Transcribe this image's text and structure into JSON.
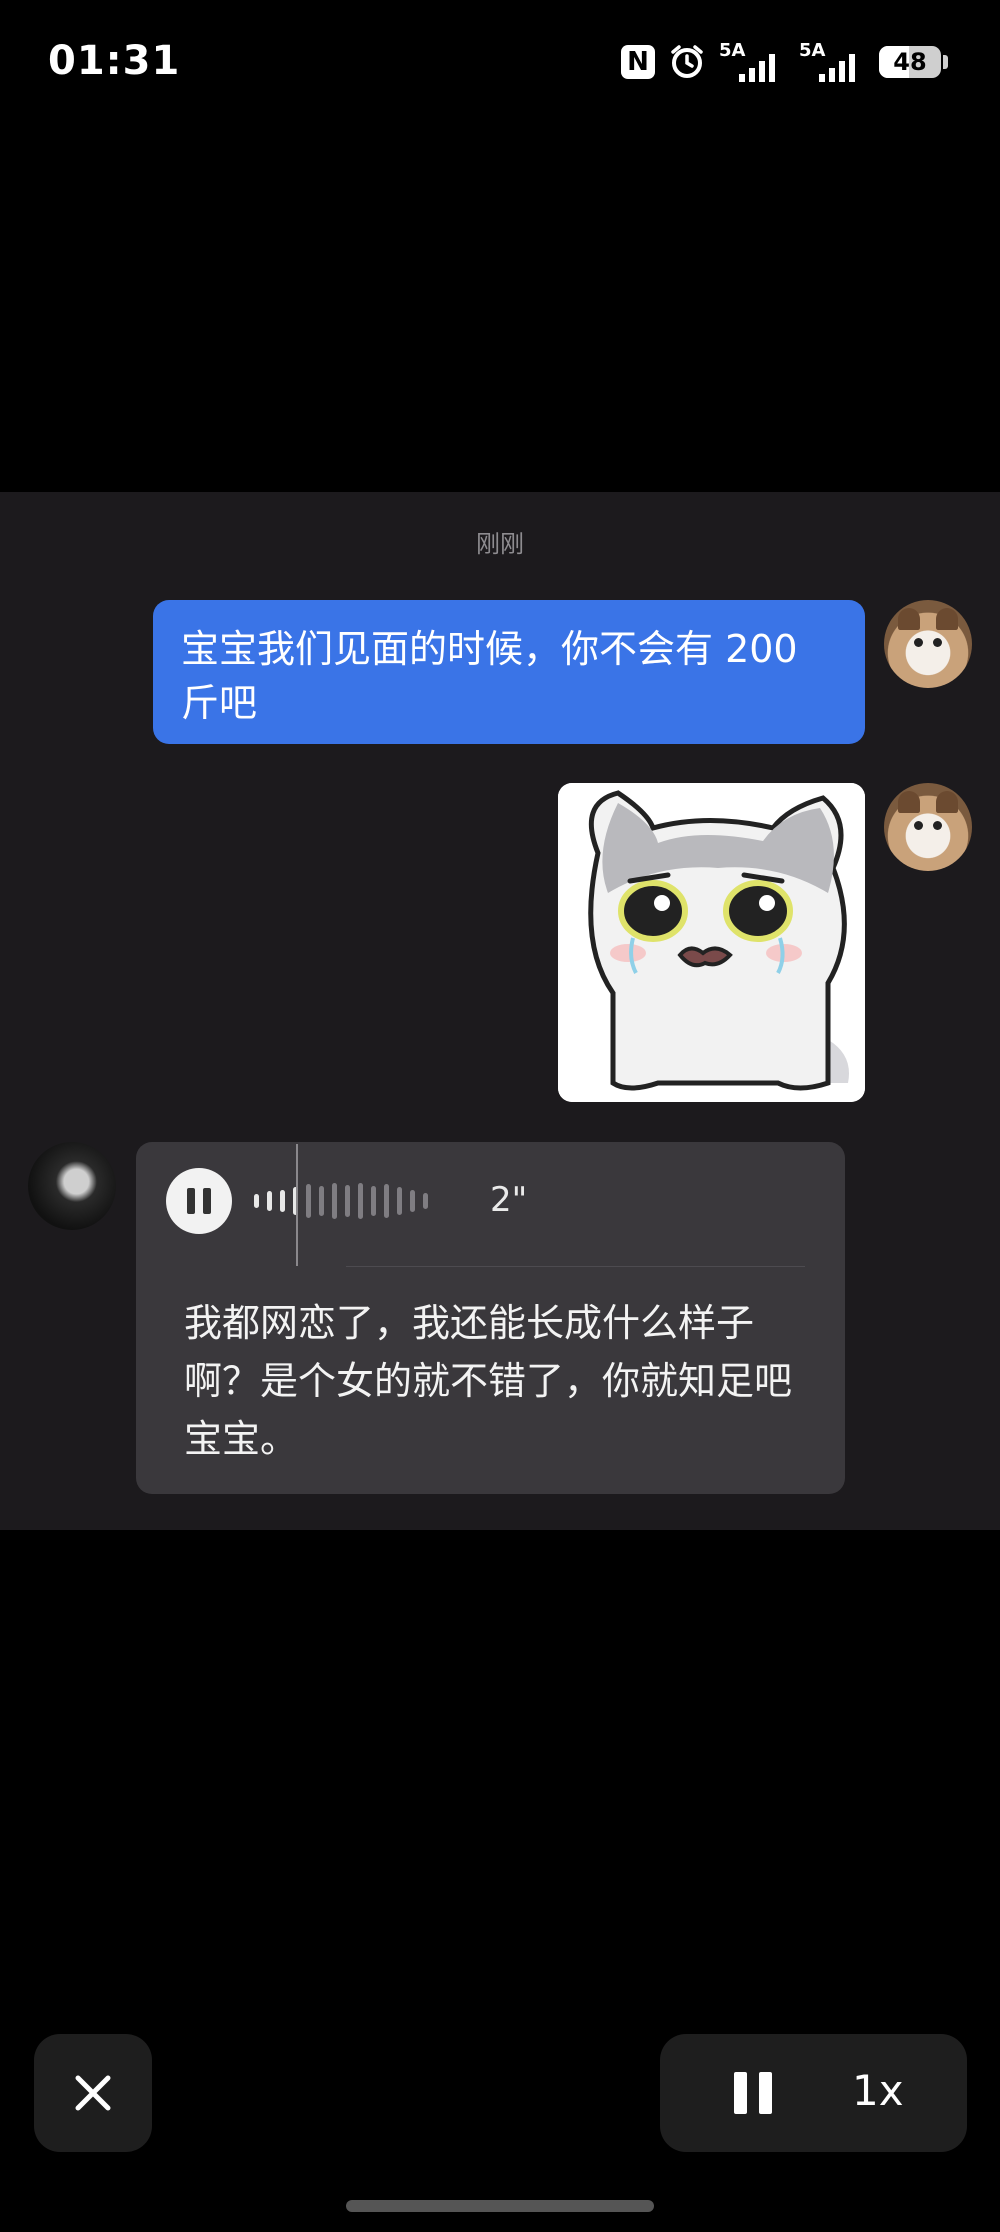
{
  "status_bar": {
    "time": "01:31",
    "nfc_label": "N",
    "network_label_1": "5A",
    "network_label_2": "5A",
    "battery_level": "48",
    "battery_fraction": 0.48
  },
  "chat": {
    "timestamp": "刚刚",
    "sent_message": "宝宝我们见面的时候，你不会有 200 斤吧",
    "voice_message": {
      "duration": "2\"",
      "transcript": "我都网恋了，我还能长成什么样子啊？是个女的就不错了，你就知足吧宝宝。"
    }
  },
  "controls": {
    "speed": "1x"
  },
  "icons": {
    "close": "close-icon",
    "pause": "pause-icon",
    "nfc": "nfc-icon",
    "alarm": "alarm-icon",
    "signal": "signal-icon",
    "battery": "battery-icon"
  }
}
